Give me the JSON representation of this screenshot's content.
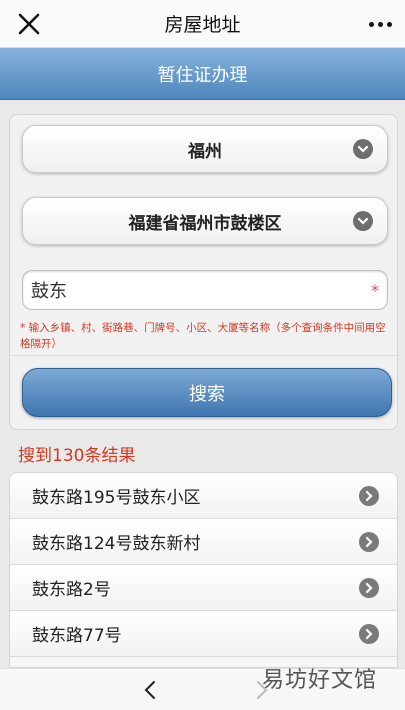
{
  "header": {
    "title": "房屋地址",
    "close_icon": "close-icon",
    "more_icon": "more-icon"
  },
  "banner": {
    "title": "暂住证办理"
  },
  "form": {
    "city": "福州",
    "district": "福建省福州市鼓楼区",
    "keyword": "鼓东",
    "required_mark": "*",
    "hint": "* 输入乡镇、村、街路巷、门牌号、小区、大厦等名称（多个查询条件中间用空格隔开）",
    "search_label": "搜索"
  },
  "results": {
    "count_text": "搜到130条结果",
    "items": [
      {
        "label": "鼓东路195号鼓东小区"
      },
      {
        "label": "鼓东路124号鼓东新村"
      },
      {
        "label": "鼓东路2号"
      },
      {
        "label": "鼓东路77号"
      }
    ]
  },
  "footer": {
    "watermark": "易坊好文馆"
  },
  "colors": {
    "accent": "#4f86bd",
    "warning": "#d9361e"
  }
}
